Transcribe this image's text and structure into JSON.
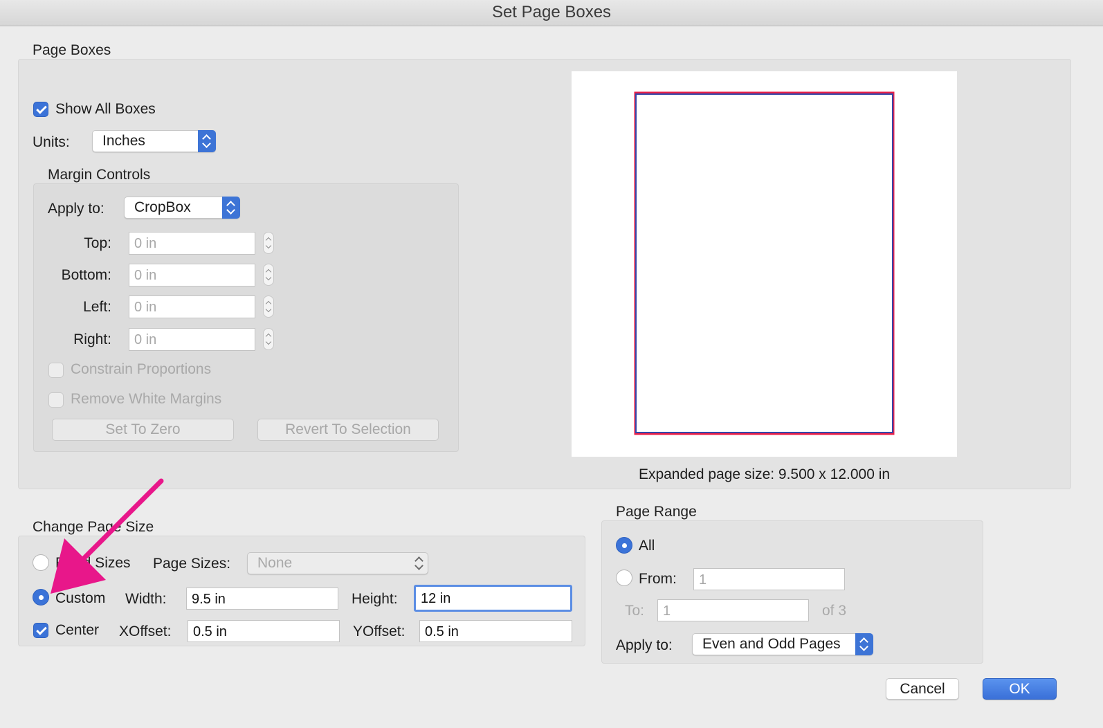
{
  "window": {
    "title": "Set Page Boxes"
  },
  "page_boxes": {
    "group_label": "Page Boxes",
    "show_all_boxes": {
      "label": "Show All Boxes",
      "checked": true
    },
    "units": {
      "label": "Units:",
      "value": "Inches"
    },
    "margin_controls": {
      "group_label": "Margin Controls",
      "apply_to": {
        "label": "Apply to:",
        "value": "CropBox"
      },
      "top": {
        "label": "Top:",
        "value": "0 in"
      },
      "bottom": {
        "label": "Bottom:",
        "value": "0 in"
      },
      "left": {
        "label": "Left:",
        "value": "0 in"
      },
      "right": {
        "label": "Right:",
        "value": "0 in"
      },
      "constrain_proportions": {
        "label": "Constrain Proportions",
        "checked": false
      },
      "remove_white_margins": {
        "label": "Remove White Margins",
        "checked": false
      },
      "set_to_zero_label": "Set To Zero",
      "revert_label": "Revert To Selection"
    },
    "preview": {
      "caption": "Expanded page size: 9.500 x 12.000 in",
      "box_colors": [
        "#e8214a",
        "#3547a8"
      ]
    }
  },
  "change_page_size": {
    "group_label": "Change Page Size",
    "fixed_sizes": {
      "label": "Fixed Sizes",
      "selected": false
    },
    "page_sizes": {
      "label": "Page Sizes:",
      "value": "None"
    },
    "custom": {
      "label": "Custom",
      "selected": true
    },
    "width": {
      "label": "Width:",
      "value": "9.5 in"
    },
    "height": {
      "label": "Height:",
      "value": "12 in"
    },
    "center": {
      "label": "Center",
      "checked": true
    },
    "xoffset": {
      "label": "XOffset:",
      "value": "0.5 in"
    },
    "yoffset": {
      "label": "YOffset:",
      "value": "0.5 in"
    }
  },
  "page_range": {
    "group_label": "Page Range",
    "all": {
      "label": "All",
      "selected": true
    },
    "from": {
      "label": "From:",
      "value": "1",
      "selected": false
    },
    "to": {
      "label": "To:",
      "value": "1"
    },
    "of_total": "of 3",
    "apply_to": {
      "label": "Apply to:",
      "value": "Even and Odd Pages"
    }
  },
  "buttons": {
    "cancel": "Cancel",
    "ok": "OK"
  },
  "annotation": {
    "arrow_color": "#e8178a"
  }
}
